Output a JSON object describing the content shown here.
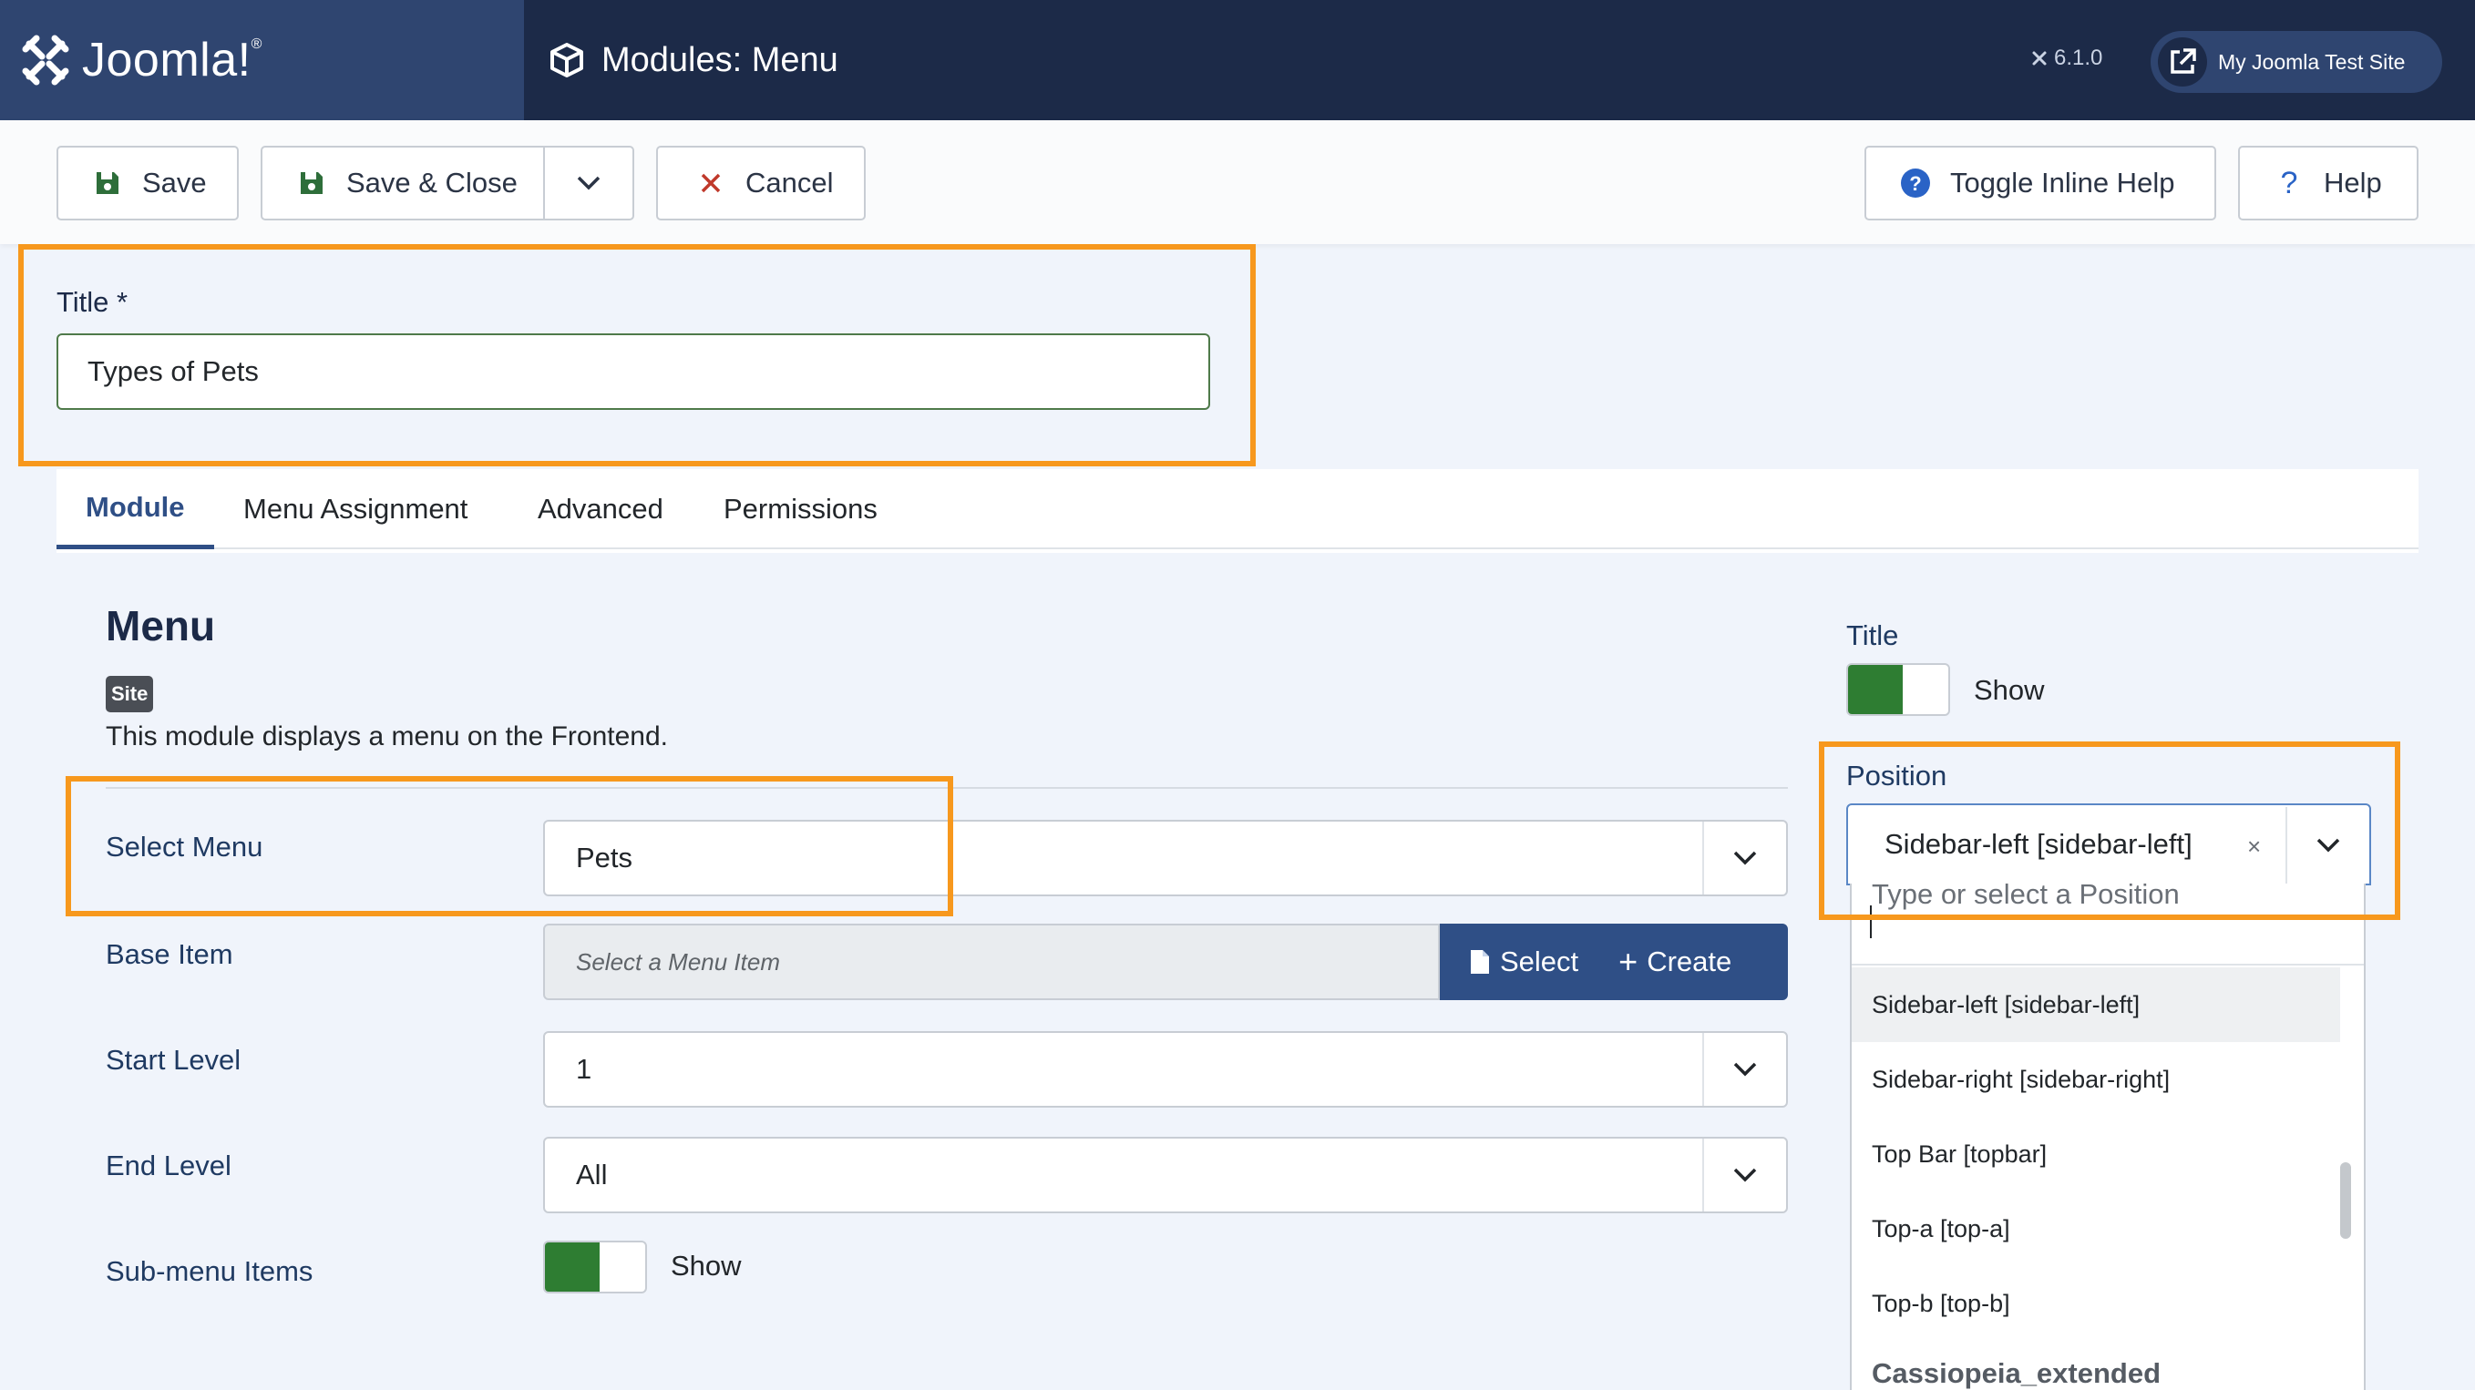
{
  "header": {
    "logo_text": "Joomla!",
    "page_title": "Modules: Menu",
    "version": "6.1.0",
    "site_button_label": "My Joomla Test Site"
  },
  "toolbar": {
    "save_label": "Save",
    "save_close_label": "Save & Close",
    "cancel_label": "Cancel",
    "toggle_help_label": "Toggle Inline Help",
    "help_label": "Help"
  },
  "title_field": {
    "label": "Title *",
    "value": "Types of Pets"
  },
  "tabs": [
    {
      "label": "Module",
      "active": true
    },
    {
      "label": "Menu Assignment",
      "active": false
    },
    {
      "label": "Advanced",
      "active": false
    },
    {
      "label": "Permissions",
      "active": false
    }
  ],
  "module": {
    "heading": "Menu",
    "badge": "Site",
    "description": "This module displays a menu on the Frontend."
  },
  "fields": {
    "select_menu": {
      "label": "Select Menu",
      "value": "Pets"
    },
    "base_item": {
      "label": "Base Item",
      "placeholder": "Select a Menu Item",
      "select_label": "Select",
      "create_label": "Create"
    },
    "start_level": {
      "label": "Start Level",
      "value": "1"
    },
    "end_level": {
      "label": "End Level",
      "value": "All"
    },
    "submenu_items": {
      "label": "Sub-menu Items",
      "state": "Show"
    }
  },
  "right": {
    "title_label": "Title",
    "title_state": "Show",
    "position_label": "Position",
    "position_value": "Sidebar-left [sidebar-left]",
    "clear_glyph": "×",
    "search_placeholder": "Type or select a Position",
    "options": [
      "Sidebar-left [sidebar-left]",
      "Sidebar-right [sidebar-right]",
      "Top Bar [topbar]",
      "Top-a [top-a]",
      "Top-b [top-b]"
    ],
    "group_label": "Cassiopeia_extended"
  },
  "colors": {
    "header_bg": "#1c2a48",
    "accent": "#2f4f86",
    "highlight": "#f7981d",
    "switch_on": "#2e7d32",
    "cancel_x": "#c0392b"
  }
}
